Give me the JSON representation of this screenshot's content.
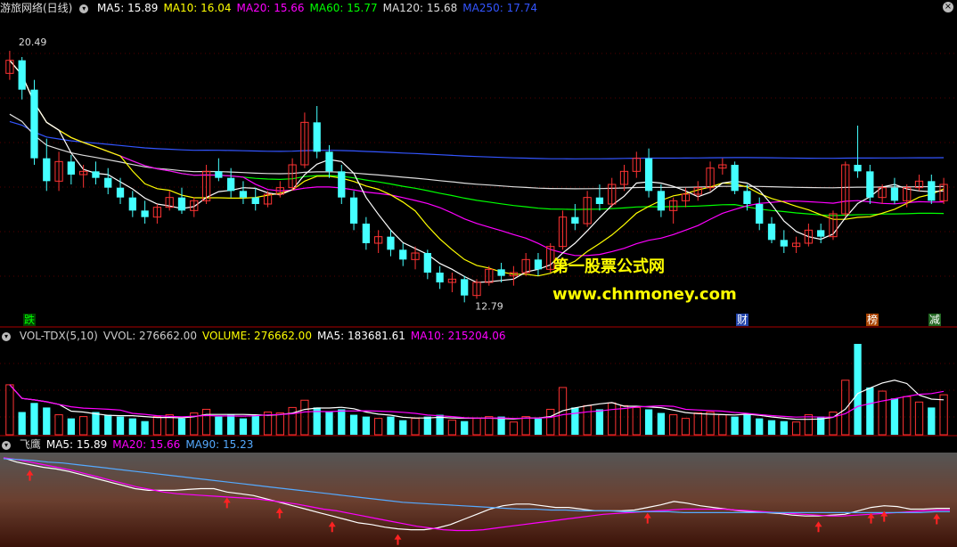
{
  "main": {
    "title": "游旅网络(日线)",
    "ma_legend": [
      {
        "label": "MA5: 15.89",
        "color": "#ffffff"
      },
      {
        "label": "MA10: 16.04",
        "color": "#ffff00"
      },
      {
        "label": "MA20: 15.66",
        "color": "#ff00ff"
      },
      {
        "label": "MA60: 15.77",
        "color": "#00ff00"
      },
      {
        "label": "MA120: 15.68",
        "color": "#dddddd"
      },
      {
        "label": "MA250: 17.74",
        "color": "#3355ff"
      }
    ],
    "high_label": "20.49",
    "low_label": "12.79",
    "watermark_cn": "第一股票公式网",
    "watermark_url": "www.chnmoney.com",
    "events": [
      {
        "text": "跌",
        "color": "#00ff00",
        "bg": "#004400"
      },
      {
        "text": "财",
        "color": "#ffffff",
        "bg": "#2244aa"
      },
      {
        "text": "榜",
        "color": "#ffffff",
        "bg": "#aa4400"
      },
      {
        "text": "减",
        "color": "#ffffff",
        "bg": "#226622"
      }
    ]
  },
  "volume": {
    "legend": [
      {
        "label": "VOL-TDX(5,10)",
        "color": "#cccccc"
      },
      {
        "label": "VVOL: 276662.00",
        "color": "#cccccc"
      },
      {
        "label": "VOLUME: 276662.00",
        "color": "#ffff00"
      },
      {
        "label": "MA5: 183681.61",
        "color": "#ffffff"
      },
      {
        "label": "MA10: 215204.06",
        "color": "#ff00ff"
      }
    ]
  },
  "indicator": {
    "legend": [
      {
        "label": "飞鹰",
        "color": "#cccccc"
      },
      {
        "label": "MA5: 15.89",
        "color": "#ffffff"
      },
      {
        "label": "MA20: 15.66",
        "color": "#ff00ff"
      },
      {
        "label": "MA90: 15.23",
        "color": "#55aaff"
      }
    ]
  },
  "colors": {
    "up": "#ff3333",
    "down": "#44ffff"
  },
  "chart_data": [
    {
      "type": "candlestick",
      "ylim": [
        12.5,
        21.5
      ],
      "ohlc": [
        [
          19.8,
          20.49,
          19.6,
          20.2
        ],
        [
          20.2,
          20.3,
          19.0,
          19.3
        ],
        [
          19.3,
          19.6,
          17.0,
          17.2
        ],
        [
          17.2,
          17.8,
          16.2,
          16.5
        ],
        [
          16.5,
          17.4,
          16.2,
          17.1
        ],
        [
          17.1,
          17.3,
          16.4,
          16.7
        ],
        [
          16.7,
          17.0,
          16.3,
          16.8
        ],
        [
          16.8,
          17.1,
          16.4,
          16.6
        ],
        [
          16.6,
          16.9,
          16.1,
          16.3
        ],
        [
          16.3,
          16.6,
          15.8,
          16.0
        ],
        [
          16.0,
          16.2,
          15.4,
          15.6
        ],
        [
          15.6,
          15.9,
          15.2,
          15.4
        ],
        [
          15.4,
          15.8,
          15.2,
          15.7
        ],
        [
          15.7,
          16.2,
          15.6,
          16.0
        ],
        [
          16.0,
          16.3,
          15.5,
          15.6
        ],
        [
          15.6,
          16.0,
          15.4,
          15.9
        ],
        [
          15.9,
          17.0,
          15.8,
          16.8
        ],
        [
          16.8,
          17.2,
          16.5,
          16.6
        ],
        [
          16.6,
          16.9,
          16.0,
          16.2
        ],
        [
          16.2,
          16.5,
          15.8,
          16.0
        ],
        [
          16.0,
          16.3,
          15.6,
          15.8
        ],
        [
          15.8,
          16.2,
          15.7,
          16.1
        ],
        [
          16.1,
          16.5,
          16.0,
          16.3
        ],
        [
          16.3,
          17.2,
          16.2,
          17.0
        ],
        [
          17.0,
          18.6,
          16.9,
          18.3
        ],
        [
          18.3,
          18.8,
          17.2,
          17.4
        ],
        [
          17.4,
          17.6,
          16.6,
          16.8
        ],
        [
          16.8,
          17.0,
          15.8,
          16.0
        ],
        [
          16.0,
          16.2,
          15.0,
          15.2
        ],
        [
          15.2,
          15.4,
          14.4,
          14.6
        ],
        [
          14.6,
          15.0,
          14.3,
          14.8
        ],
        [
          14.8,
          15.0,
          14.2,
          14.4
        ],
        [
          14.4,
          14.6,
          13.9,
          14.1
        ],
        [
          14.1,
          14.5,
          13.8,
          14.3
        ],
        [
          14.3,
          14.4,
          13.5,
          13.7
        ],
        [
          13.7,
          13.9,
          13.2,
          13.4
        ],
        [
          13.4,
          13.7,
          13.1,
          13.5
        ],
        [
          13.5,
          13.6,
          12.79,
          13.0
        ],
        [
          13.0,
          13.5,
          12.9,
          13.4
        ],
        [
          13.4,
          13.9,
          13.3,
          13.8
        ],
        [
          13.8,
          14.0,
          13.4,
          13.6
        ],
        [
          13.6,
          13.9,
          13.3,
          13.7
        ],
        [
          13.7,
          14.3,
          13.6,
          14.1
        ],
        [
          14.1,
          14.3,
          13.6,
          13.8
        ],
        [
          13.8,
          14.6,
          13.7,
          14.5
        ],
        [
          14.5,
          15.6,
          14.4,
          15.4
        ],
        [
          15.4,
          15.8,
          15.0,
          15.2
        ],
        [
          15.2,
          16.2,
          15.1,
          16.0
        ],
        [
          16.0,
          16.4,
          15.6,
          15.8
        ],
        [
          15.8,
          16.6,
          15.7,
          16.4
        ],
        [
          16.4,
          17.0,
          16.2,
          16.8
        ],
        [
          16.8,
          17.4,
          16.6,
          17.2
        ],
        [
          17.2,
          17.5,
          16.0,
          16.2
        ],
        [
          16.2,
          16.4,
          15.4,
          15.6
        ],
        [
          15.6,
          16.0,
          15.2,
          15.9
        ],
        [
          15.9,
          16.3,
          15.7,
          16.1
        ],
        [
          16.1,
          16.5,
          15.9,
          16.3
        ],
        [
          16.3,
          17.1,
          16.2,
          16.9
        ],
        [
          16.9,
          17.2,
          16.7,
          17.0
        ],
        [
          17.0,
          17.1,
          16.1,
          16.2
        ],
        [
          16.2,
          16.4,
          15.6,
          15.8
        ],
        [
          15.8,
          16.0,
          15.0,
          15.2
        ],
        [
          15.2,
          15.4,
          14.6,
          14.7
        ],
        [
          14.7,
          15.0,
          14.3,
          14.5
        ],
        [
          14.5,
          14.8,
          14.3,
          14.6
        ],
        [
          14.6,
          15.2,
          14.5,
          15.0
        ],
        [
          15.0,
          15.2,
          14.6,
          14.8
        ],
        [
          14.8,
          15.6,
          14.7,
          15.5
        ],
        [
          15.5,
          17.1,
          15.4,
          17.0
        ],
        [
          17.0,
          18.2,
          16.6,
          16.8
        ],
        [
          16.8,
          17.0,
          15.8,
          16.0
        ],
        [
          16.0,
          16.4,
          15.8,
          16.3
        ],
        [
          16.3,
          16.6,
          15.8,
          15.9
        ],
        [
          15.9,
          16.4,
          15.7,
          16.3
        ],
        [
          16.3,
          16.7,
          16.2,
          16.5
        ],
        [
          16.5,
          16.7,
          15.8,
          15.9
        ],
        [
          15.9,
          16.6,
          15.8,
          16.4
        ]
      ]
    },
    {
      "type": "bar",
      "values": [
        0.55,
        0.25,
        0.35,
        0.3,
        0.22,
        0.18,
        0.2,
        0.25,
        0.22,
        0.2,
        0.18,
        0.15,
        0.2,
        0.22,
        0.18,
        0.24,
        0.28,
        0.2,
        0.22,
        0.18,
        0.22,
        0.25,
        0.24,
        0.3,
        0.38,
        0.3,
        0.25,
        0.28,
        0.22,
        0.2,
        0.18,
        0.2,
        0.16,
        0.18,
        0.2,
        0.22,
        0.16,
        0.15,
        0.18,
        0.2,
        0.2,
        0.14,
        0.2,
        0.18,
        0.28,
        0.52,
        0.3,
        0.32,
        0.28,
        0.35,
        0.32,
        0.3,
        0.28,
        0.24,
        0.22,
        0.18,
        0.24,
        0.25,
        0.22,
        0.2,
        0.22,
        0.18,
        0.16,
        0.15,
        0.14,
        0.22,
        0.2,
        0.25,
        0.6,
        1.0,
        0.52,
        0.48,
        0.4,
        0.42,
        0.36,
        0.3,
        0.44
      ]
    },
    {
      "type": "line",
      "series": [
        {
          "name": "MA5",
          "values": [
            0.98,
            0.93,
            0.9,
            0.87,
            0.85,
            0.82,
            0.78,
            0.74,
            0.7,
            0.66,
            0.62,
            0.6,
            0.6,
            0.6,
            0.61,
            0.62,
            0.62,
            0.58,
            0.56,
            0.54,
            0.5,
            0.46,
            0.42,
            0.38,
            0.34,
            0.3,
            0.26,
            0.22,
            0.2,
            0.17,
            0.15,
            0.14,
            0.14,
            0.16,
            0.2,
            0.26,
            0.32,
            0.38,
            0.42,
            0.44,
            0.44,
            0.42,
            0.4,
            0.4,
            0.38,
            0.36,
            0.36,
            0.36,
            0.37,
            0.4,
            0.43,
            0.47,
            0.45,
            0.42,
            0.4,
            0.38,
            0.36,
            0.35,
            0.34,
            0.33,
            0.31,
            0.3,
            0.3,
            0.31,
            0.32,
            0.36,
            0.4,
            0.42,
            0.41,
            0.38,
            0.38,
            0.39,
            0.39
          ]
        },
        {
          "name": "MA20",
          "values": [
            0.98,
            0.96,
            0.93,
            0.9,
            0.87,
            0.84,
            0.8,
            0.76,
            0.72,
            0.68,
            0.64,
            0.61,
            0.58,
            0.56,
            0.55,
            0.54,
            0.53,
            0.52,
            0.51,
            0.5,
            0.48,
            0.46,
            0.44,
            0.41,
            0.38,
            0.36,
            0.33,
            0.3,
            0.27,
            0.24,
            0.21,
            0.18,
            0.16,
            0.14,
            0.13,
            0.13,
            0.14,
            0.16,
            0.18,
            0.2,
            0.22,
            0.24,
            0.26,
            0.28,
            0.3,
            0.32,
            0.33,
            0.34,
            0.35,
            0.36,
            0.37,
            0.38,
            0.38,
            0.38,
            0.38,
            0.37,
            0.36,
            0.35,
            0.34,
            0.33,
            0.32,
            0.31,
            0.3,
            0.3,
            0.31,
            0.32,
            0.33,
            0.34,
            0.35,
            0.36,
            0.37,
            0.37
          ]
        },
        {
          "name": "MA90",
          "values": [
            0.97,
            0.96,
            0.95,
            0.93,
            0.92,
            0.9,
            0.88,
            0.86,
            0.84,
            0.82,
            0.8,
            0.78,
            0.76,
            0.74,
            0.72,
            0.7,
            0.68,
            0.66,
            0.64,
            0.62,
            0.6,
            0.58,
            0.56,
            0.54,
            0.52,
            0.5,
            0.48,
            0.46,
            0.45,
            0.44,
            0.43,
            0.42,
            0.41,
            0.4,
            0.39,
            0.38,
            0.38,
            0.37,
            0.37,
            0.36,
            0.36,
            0.36,
            0.35,
            0.35,
            0.35,
            0.35,
            0.34,
            0.34,
            0.34,
            0.34,
            0.34,
            0.34,
            0.34,
            0.34,
            0.34,
            0.34,
            0.34,
            0.34,
            0.34,
            0.34,
            0.34,
            0.34,
            0.34,
            0.35,
            0.35
          ]
        }
      ],
      "ylim": [
        0,
        1
      ]
    }
  ]
}
